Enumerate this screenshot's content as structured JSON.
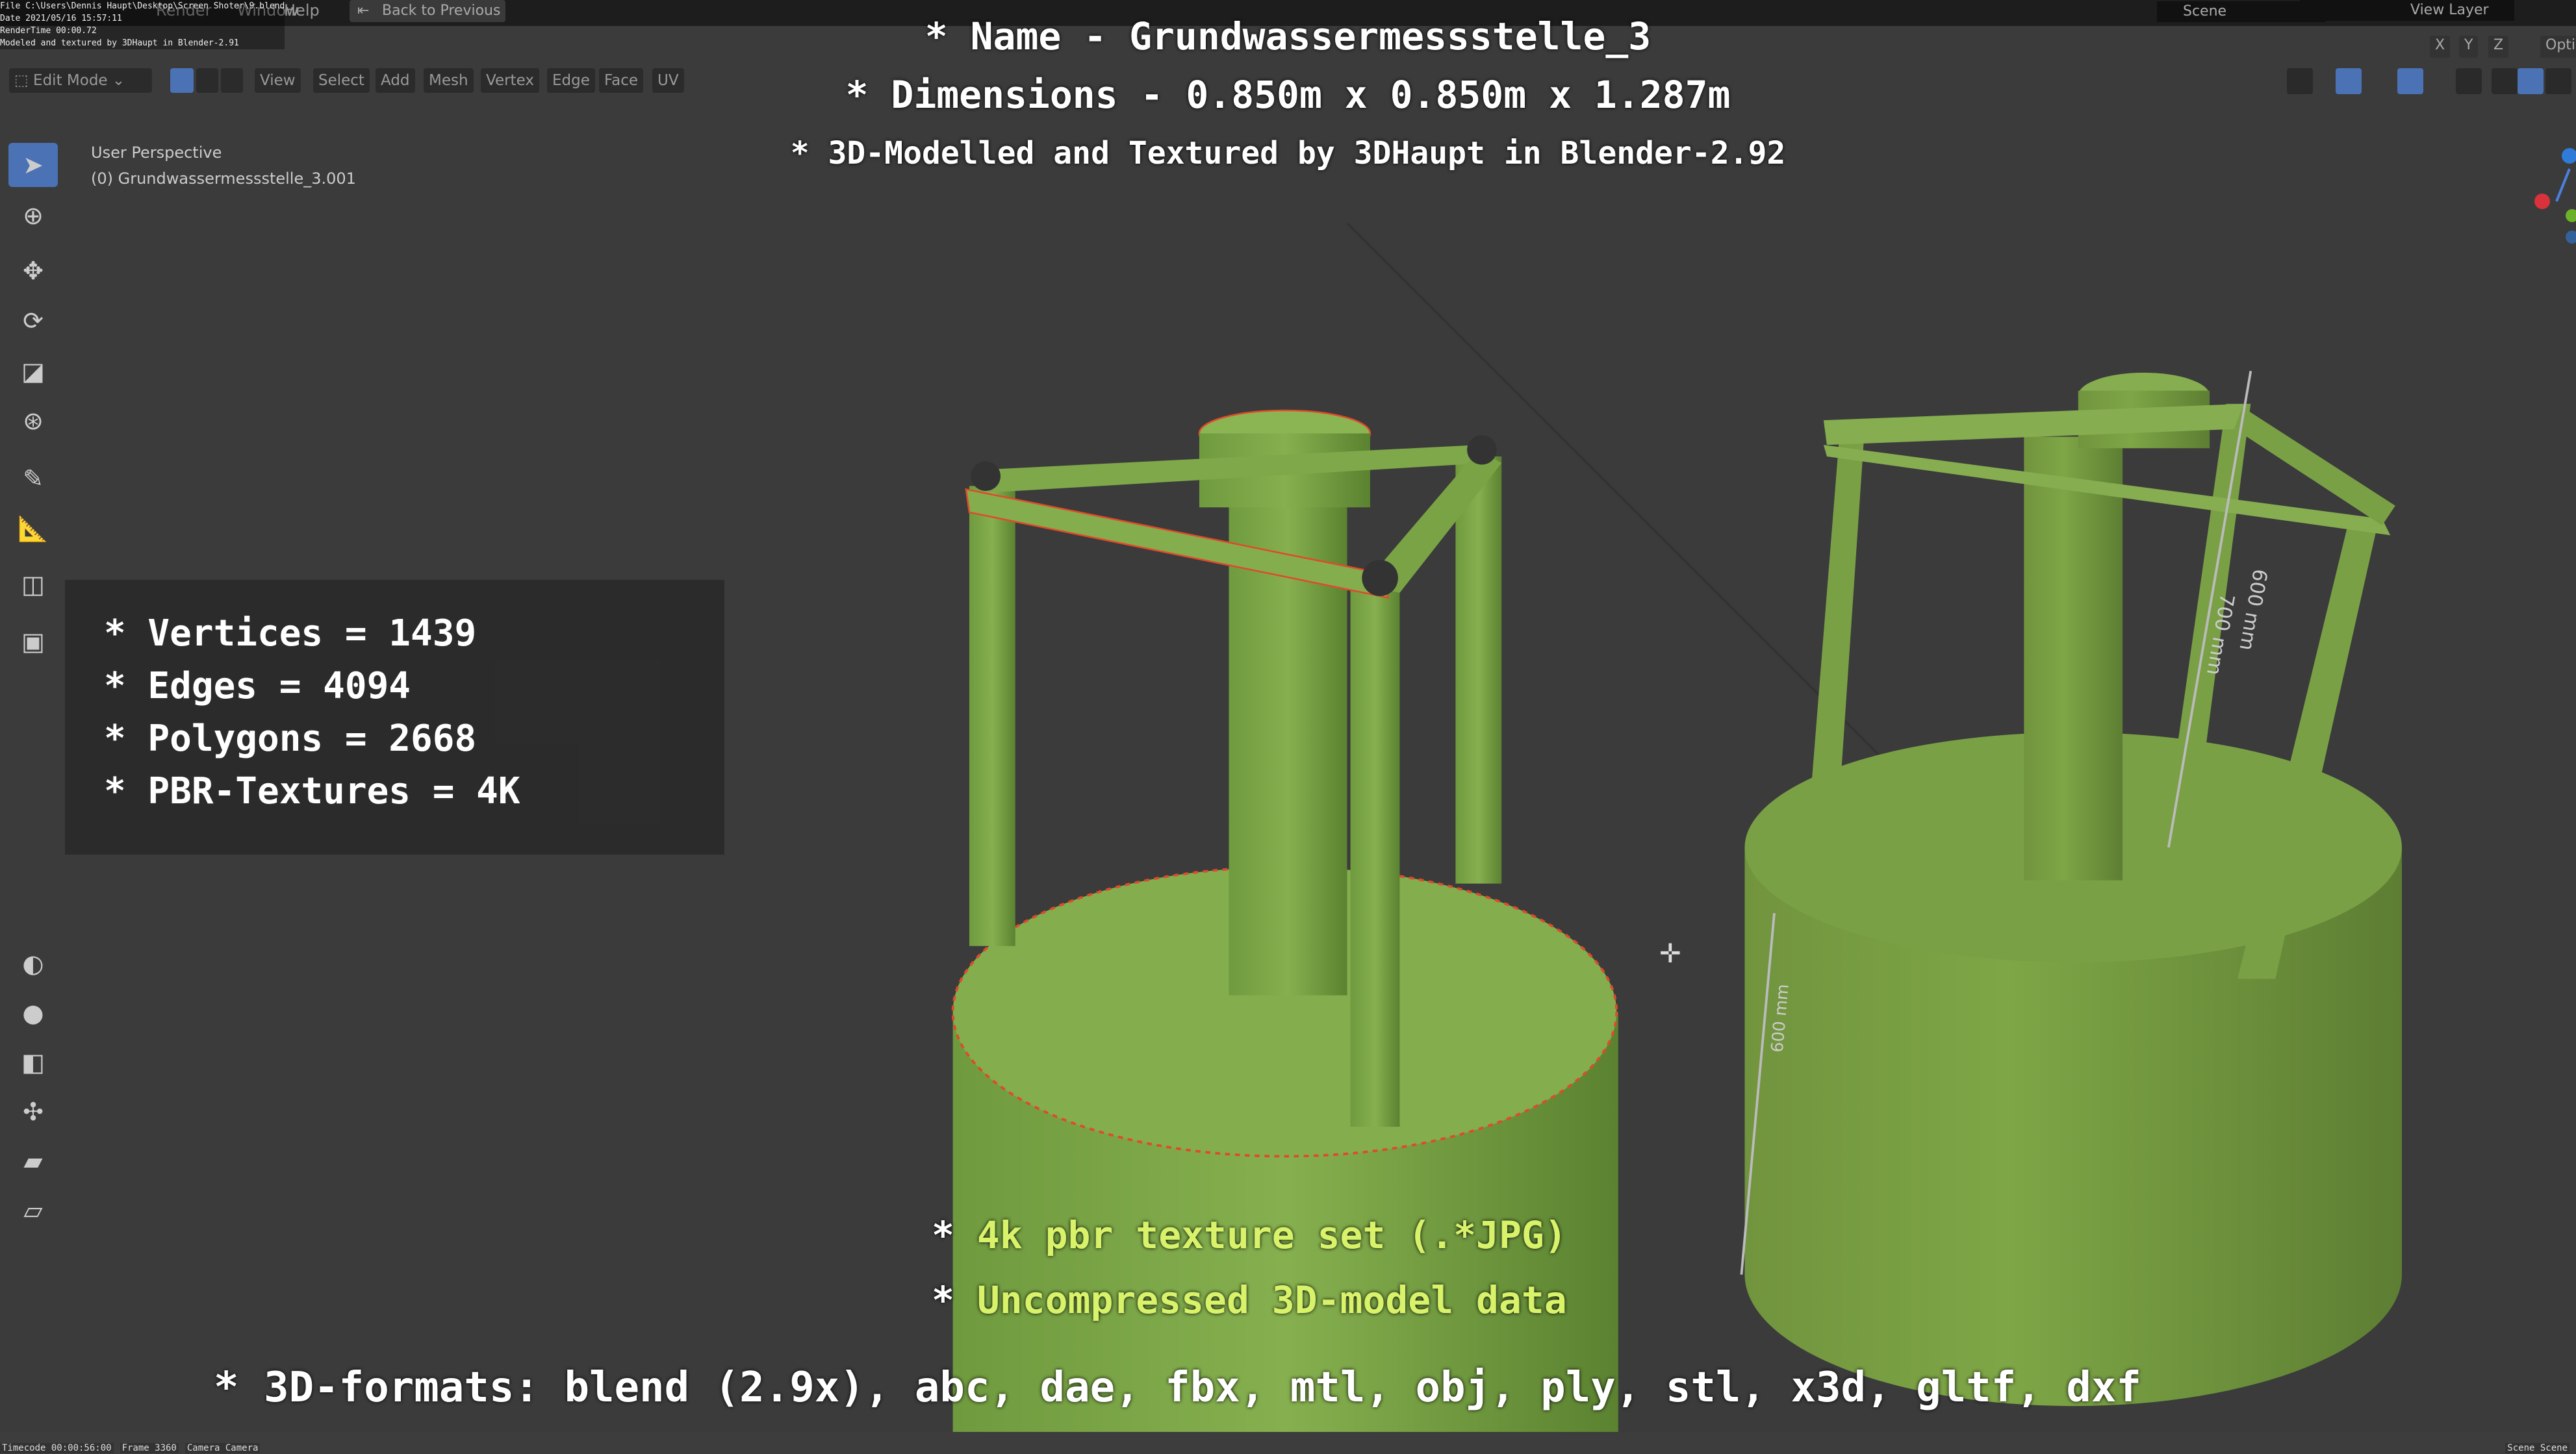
{
  "file_info": {
    "file": "File C:\\Users\\Dennis Haupt\\Desktop\\Screen Shoter\\9.blend",
    "date": "Date 2021/05/16 15:57:11",
    "render_time": "RenderTime 00:00.72",
    "credit": "Modeled and textured by 3DHaupt in Blender-2.91"
  },
  "menu": {
    "help": "Help",
    "back": "Back to Previous",
    "window": "Window",
    "render": "Render"
  },
  "top_right": {
    "scene": "Scene",
    "view_layer": "View Layer",
    "x": "X",
    "y": "Y",
    "z": "Z",
    "options": "Opti"
  },
  "header": {
    "mode": "Edit Mode",
    "items": [
      "View",
      "Select",
      "Add",
      "Mesh",
      "Vertex",
      "Edge",
      "Face",
      "UV"
    ]
  },
  "viewport": {
    "perspective": "User Perspective",
    "object": "(0) Grundwassermessstelle_3.001"
  },
  "overlay": {
    "name": "* Name - Grundwassermessstelle_3",
    "dimensions": "* Dimensions -  0.850m x 0.850m x 1.287m",
    "modelled": "* 3D-Modelled and Textured by 3DHaupt in Blender-2.92"
  },
  "stats": [
    "* Vertices = 1439",
    "* Edges = 4094",
    "* Polygons = 2668",
    "* PBR-Textures = 4K"
  ],
  "bottom": {
    "bullet": "* ",
    "texture": "4k pbr texture set (.*JPG)",
    "uncompressed": "Uncompressed 3D-model data",
    "formats": "* 3D-formats: blend (2.9x), abc, dae, fbx, mtl, obj, ply, stl, x3d, gltf, dxf"
  },
  "measure": {
    "a": "600 mm",
    "b": "700 mm",
    "c": "600 mm"
  },
  "status": {
    "timecode": "Timecode 00:00:56:00",
    "frame": "Frame 3360",
    "camera": "Camera Camera",
    "scene": "Scene Scene"
  },
  "colors": {
    "accent": "#4a72b5",
    "mesh_green": "#7da64a",
    "highlight": "#d8f26a",
    "edge_red": "#e04a2a"
  }
}
